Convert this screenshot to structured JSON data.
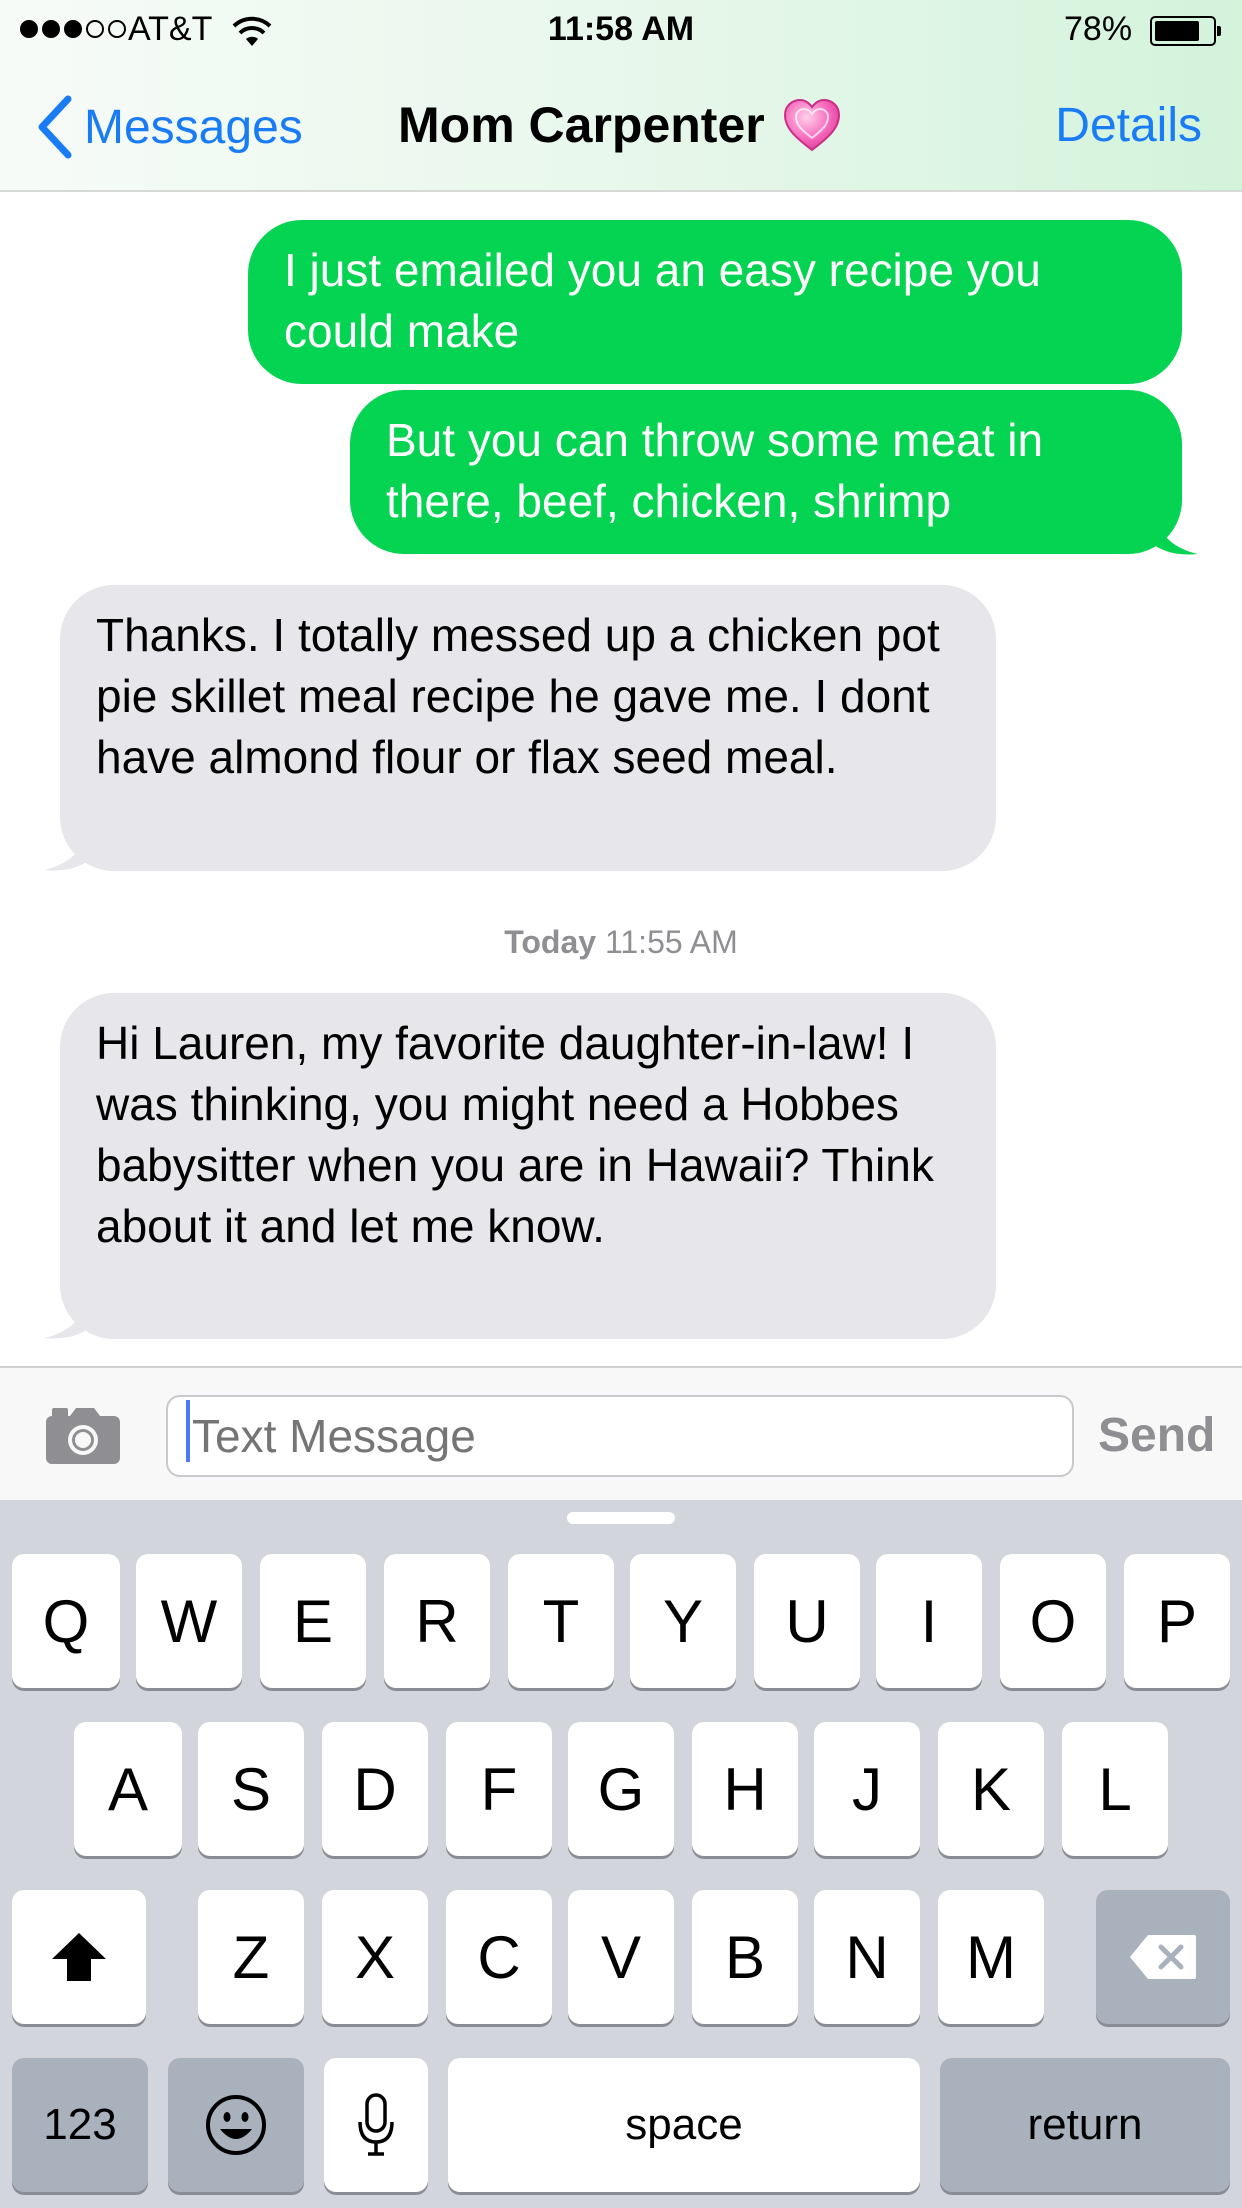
{
  "status_bar": {
    "carrier": "AT&T",
    "signal_bars_filled": 3,
    "signal_bars_total": 5,
    "time": "11:58 AM",
    "battery": "78%",
    "battery_level": 0.78
  },
  "nav": {
    "back_label": "Messages",
    "title": "Mom Carpenter",
    "title_icon": "pink-heart-icon",
    "details_label": "Details"
  },
  "messages": [
    {
      "direction": "outgoing",
      "text": "I just emailed you an easy recipe you could make"
    },
    {
      "direction": "outgoing",
      "text": "But you can throw some meat in there, beef, chicken, shrimp"
    },
    {
      "direction": "incoming",
      "text": "Thanks. I totally messed up a chicken pot pie skillet meal recipe he gave me. I dont have almond flour or flax seed meal."
    },
    {
      "direction": "incoming",
      "text": "Hi Lauren, my favorite daughter-in-law! I was thinking, you might need a Hobbes babysitter when you are in Hawaii? Think about it and let me know."
    }
  ],
  "timestamp": {
    "day": "Today",
    "time": "11:55 AM"
  },
  "composer": {
    "camera_icon": "camera-icon",
    "placeholder": "Text Message",
    "value": "",
    "send_label": "Send"
  },
  "keyboard": {
    "row1": [
      "Q",
      "W",
      "E",
      "R",
      "T",
      "Y",
      "U",
      "I",
      "O",
      "P"
    ],
    "row2": [
      "A",
      "S",
      "D",
      "F",
      "G",
      "H",
      "J",
      "K",
      "L"
    ],
    "row3": [
      "Z",
      "X",
      "C",
      "V",
      "B",
      "N",
      "M"
    ],
    "numbers_label": "123",
    "space_label": "space",
    "return_label": "return",
    "shift_icon": "shift-arrow-icon",
    "delete_icon": "backspace-icon",
    "emoji_icon": "emoji-icon",
    "mic_icon": "microphone-icon"
  },
  "colors": {
    "outgoing_bubble": "#05d452",
    "incoming_bubble": "#e6e6eb",
    "ios_blue": "#1a7cf5"
  }
}
